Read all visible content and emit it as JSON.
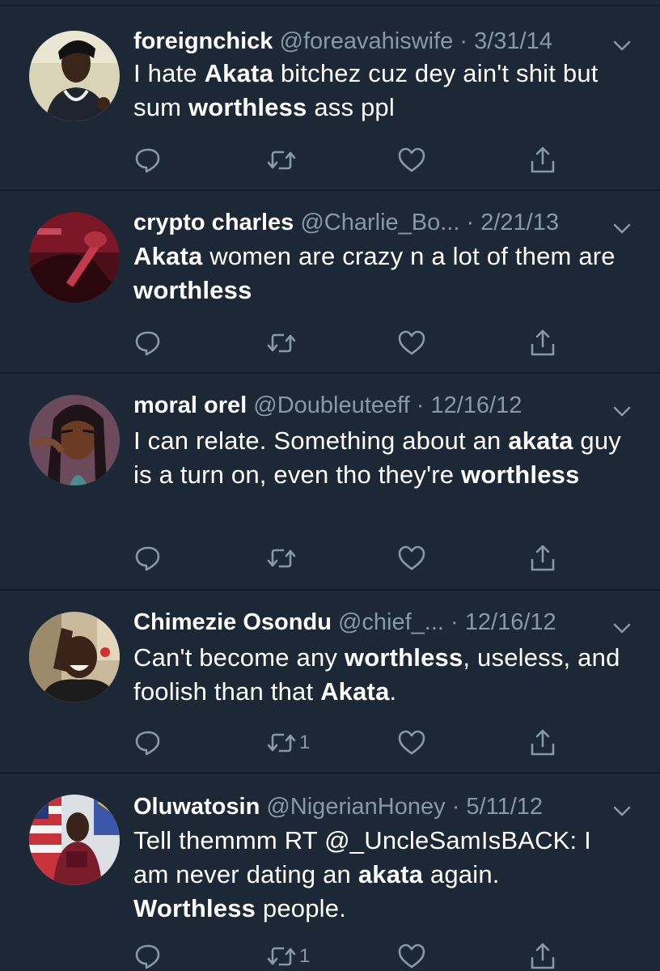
{
  "theme": {
    "background": "#1c2836",
    "text": "#ffffff",
    "muted": "#8899a6",
    "divider": "#101923"
  },
  "tweets": [
    {
      "name": "foreignchick",
      "handle": "@foreavahiswife",
      "date": "3/31/14",
      "body": [
        {
          "text": "I hate ",
          "bold": false
        },
        {
          "text": "Akata",
          "bold": true
        },
        {
          "text": " bitchez cuz dey ain't shit but sum ",
          "bold": false
        },
        {
          "text": "worthless",
          "bold": true
        },
        {
          "text": " ass ppl",
          "bold": false
        }
      ],
      "retweet_count": "",
      "avatar_icon": "avatar-photo"
    },
    {
      "name": "crypto charles",
      "handle": "@Charlie_Bo...",
      "date": "2/21/13",
      "body": [
        {
          "text": "Akata",
          "bold": true
        },
        {
          "text": " women are crazy n a lot of them are ",
          "bold": false
        },
        {
          "text": "worthless",
          "bold": true
        }
      ],
      "retweet_count": "",
      "avatar_icon": "avatar-photo"
    },
    {
      "name": "moral orel",
      "handle": "@Doubleuteeff",
      "date": "12/16/12",
      "body": [
        {
          "text": "I can relate. Something about an ",
          "bold": false
        },
        {
          "text": "akata",
          "bold": true
        },
        {
          "text": " guy is a turn on, even tho they're ",
          "bold": false
        },
        {
          "text": "worthless",
          "bold": true
        }
      ],
      "retweet_count": "",
      "avatar_icon": "avatar-photo"
    },
    {
      "name": "Chimezie Osondu",
      "handle": "@chief_...",
      "date": "12/16/12",
      "body": [
        {
          "text": "Can't become any ",
          "bold": false
        },
        {
          "text": "worthless",
          "bold": true
        },
        {
          "text": ", useless, and foolish than that ",
          "bold": false
        },
        {
          "text": "Akata",
          "bold": true
        },
        {
          "text": ".",
          "bold": false
        }
      ],
      "retweet_count": "1",
      "avatar_icon": "avatar-photo"
    },
    {
      "name": "Oluwatosin",
      "handle": "@NigerianHoney",
      "date": "5/11/12",
      "body": [
        {
          "text": "Tell themmm RT @_UncleSamIsBACK: I am never dating an ",
          "bold": false
        },
        {
          "text": "akata",
          "bold": true
        },
        {
          "text": " again. ",
          "bold": false
        },
        {
          "text": "Worthless",
          "bold": true
        },
        {
          "text": " people.",
          "bold": false
        }
      ],
      "retweet_count": "1",
      "avatar_icon": "avatar-photo"
    }
  ]
}
